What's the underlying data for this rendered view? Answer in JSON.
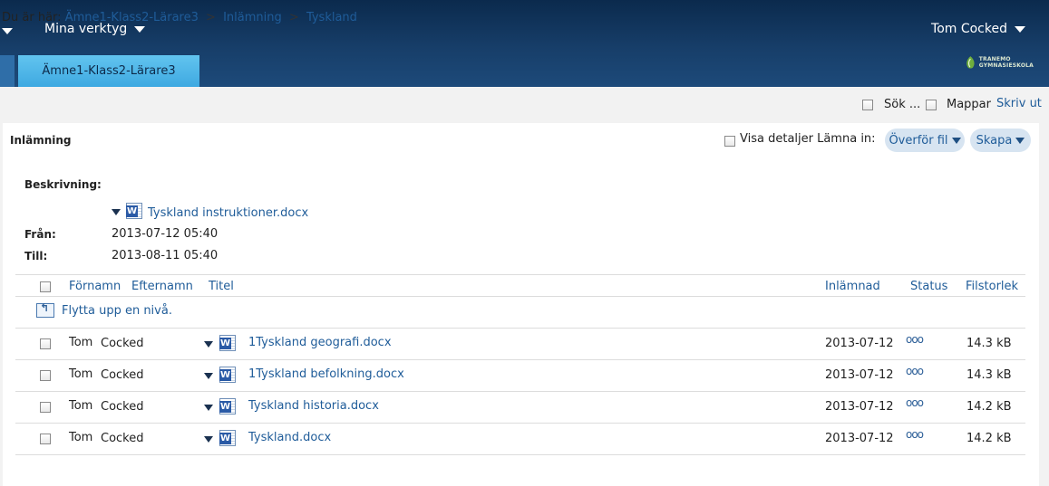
{
  "topbar": {
    "my_tools_label": "Mina verktyg",
    "user_label": "Tom Cocked",
    "site_tab": "Ämne1-Klass2-Lärare3",
    "logo_text": "TRANEMO GYMNASIESKOLA"
  },
  "breadcrumb": {
    "prefix": "Du är här:",
    "items": [
      "Ämne1-Klass2-Lärare3",
      "Inlämning",
      "Tyskland"
    ],
    "separator": ">"
  },
  "toolbar": {
    "search_label": "Sök ...",
    "folders_label": "Mappar",
    "print_label": "Skriv ut"
  },
  "panel": {
    "title": "Inlämning",
    "details_label": "Visa detaljer Lämna in:",
    "upload_label": "Överför fil",
    "create_label": "Skapa"
  },
  "assignment": {
    "description_label": "Beskrivning:",
    "attachment": "Tyskland instruktioner.docx",
    "from_label": "Från:",
    "from_value": "2013-07-12 05:40",
    "to_label": "Till:",
    "to_value": "2013-08-11 05:40"
  },
  "table": {
    "headers": {
      "first_name": "Förnamn",
      "last_name": "Efternamn",
      "title": "Titel",
      "submitted": "Inlämnad",
      "status": "Status",
      "size": "Filstorlek"
    },
    "up_level": "Flytta upp en nivå.",
    "rows": [
      {
        "first": "Tom",
        "last": "Cocked",
        "title": "1Tyskland geografi.docx",
        "date": "2013-07-12",
        "status": "ooo",
        "size": "14.3 kB"
      },
      {
        "first": "Tom",
        "last": "Cocked",
        "title": "1Tyskland befolkning.docx",
        "date": "2013-07-12",
        "status": "ooo",
        "size": "14.3 kB"
      },
      {
        "first": "Tom",
        "last": "Cocked",
        "title": "Tyskland historia.docx",
        "date": "2013-07-12",
        "status": "ooo",
        "size": "14.2 kB"
      },
      {
        "first": "Tom",
        "last": "Cocked",
        "title": "Tyskland.docx",
        "date": "2013-07-12",
        "status": "ooo",
        "size": "14.2 kB"
      }
    ]
  },
  "colors": {
    "header_dark": "#0b2a4d",
    "tab_accent": "#3ea9e1",
    "link": "#1f5c99"
  }
}
